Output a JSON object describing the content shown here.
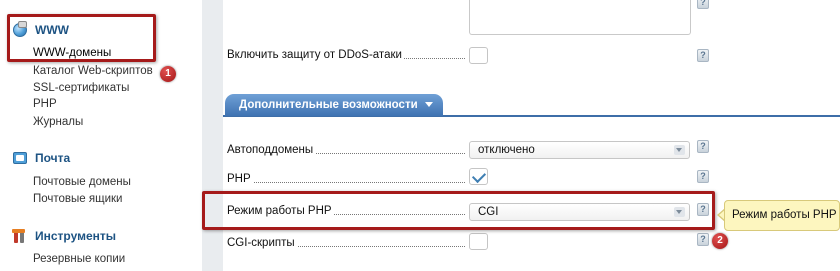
{
  "sidebar": {
    "sections": [
      {
        "title": "WWW",
        "icon": "globe-icon",
        "items": [
          "WWW-домены",
          "Каталог Web-скриптов",
          "SSL-сертификаты",
          "PHP",
          "Журналы"
        ]
      },
      {
        "title": "Почта",
        "icon": "mail-icon",
        "items": [
          "Почтовые домены",
          "Почтовые ящики"
        ]
      },
      {
        "title": "Инструменты",
        "icon": "tools-icon",
        "items": [
          "Резервные копии"
        ]
      }
    ],
    "active_item": "WWW-домены"
  },
  "form": {
    "ddos_label": "Включить защиту от DDoS-атаки",
    "ddos_checked": false,
    "tab_label": "Дополнительные возможности",
    "autosubdomains_label": "Автоподдомены",
    "autosubdomains_value": "отключено",
    "php_label": "PHP",
    "php_checked": true,
    "php_mode_label": "Режим работы PHP",
    "php_mode_value": "CGI",
    "cgi_label": "CGI-скрипты",
    "cgi_checked": false,
    "help_glyph": "?"
  },
  "annotations": {
    "badge1": "1",
    "badge2": "2",
    "tooltip": "Режим работы PHP"
  },
  "colors": {
    "accent": "#3f73b2",
    "annotation_red": "#a51a1a",
    "tooltip_bg": "#fdf6bf"
  }
}
